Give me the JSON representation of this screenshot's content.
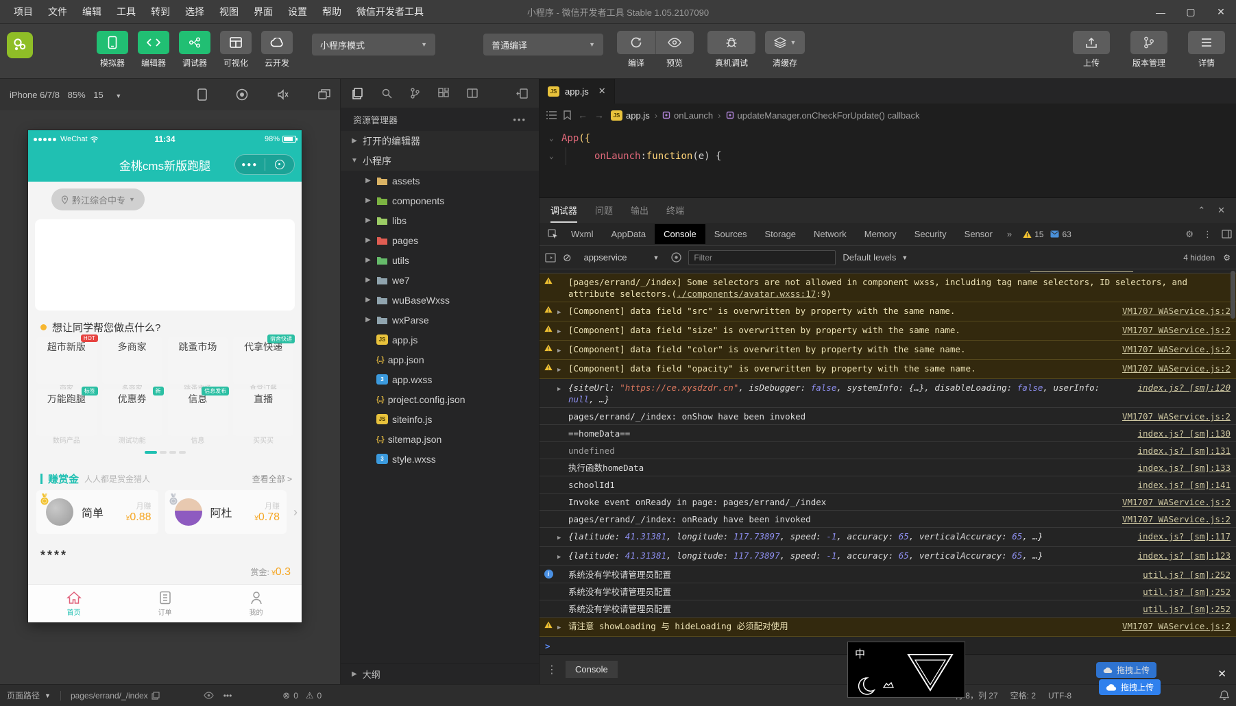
{
  "window": {
    "menu": [
      "项目",
      "文件",
      "编辑",
      "工具",
      "转到",
      "选择",
      "视图",
      "界面",
      "设置",
      "帮助",
      "微信开发者工具"
    ],
    "title": "小程序 - 微信开发者工具 Stable 1.05.2107090"
  },
  "toolbar": {
    "views": [
      {
        "label": "模拟器",
        "icon": "phone",
        "active": true
      },
      {
        "label": "编辑器",
        "icon": "code",
        "active": true
      },
      {
        "label": "调试器",
        "icon": "debug",
        "active": true
      },
      {
        "label": "可视化",
        "icon": "grid",
        "active": false
      },
      {
        "label": "云开发",
        "icon": "cloud",
        "active": false
      }
    ],
    "mode_select": "小程序模式",
    "compile_select": "普通编译",
    "compile_actions": [
      {
        "label": "编译",
        "icon": "refresh"
      },
      {
        "label": "预览",
        "icon": "eye"
      }
    ],
    "device_debug": {
      "label": "真机调试",
      "icon": "bug"
    },
    "cache": {
      "label": "清缓存",
      "icon": "layers"
    },
    "right": [
      {
        "label": "上传",
        "icon": "upload"
      },
      {
        "label": "版本管理",
        "icon": "branch"
      },
      {
        "label": "详情",
        "icon": "menu"
      }
    ]
  },
  "simulator": {
    "device": "iPhone 6/7/8",
    "zoom": "85%",
    "fps": "15"
  },
  "phone": {
    "status": {
      "carrier": "WeChat",
      "time": "11:34",
      "battery": "98%"
    },
    "nav_title": "金桃cms新版跑腿",
    "location": "黔江综合中专",
    "section_title": "想让同学帮您做点什么?",
    "grid": [
      {
        "title": "超市新版",
        "sub": "商家",
        "badge": "HOT",
        "badge_color": "#e64340"
      },
      {
        "title": "多商家",
        "sub": "多商家"
      },
      {
        "title": "跳蚤市场",
        "sub": "跳蚤市场"
      },
      {
        "title": "代拿快递",
        "sub": "食堂订餐",
        "badge": "宿舍快递",
        "badge_color": "#2bbfa3"
      },
      {
        "title": "万能跑腿",
        "sub": "数码产品",
        "badge": "标签",
        "badge_color": "#2bbfa3"
      },
      {
        "title": "优惠券",
        "sub": "测试功能",
        "badge": "新",
        "badge_color": "#2bbfa3"
      },
      {
        "title": "信息",
        "sub": "信息",
        "badge": "信息发布",
        "badge_color": "#2bbfa3"
      },
      {
        "title": "直播",
        "sub": "买买买"
      }
    ],
    "reward": {
      "title": "赚赏金",
      "subtitle": "人人都是赏金猎人",
      "more": "查看全部 >",
      "cards": [
        {
          "name": "简单",
          "label": "月赚",
          "currency": "¥",
          "amount": "0.88",
          "medal": "gold"
        },
        {
          "name": "阿杜",
          "label": "月赚",
          "currency": "¥",
          "amount": "0.78",
          "medal": "silver"
        }
      ]
    },
    "stars": "****",
    "bounty_label": "赏金:",
    "bounty_currency": "¥",
    "bounty_value": "0.3",
    "tabbar": [
      {
        "label": "首页",
        "icon": "home",
        "active": true
      },
      {
        "label": "订单",
        "icon": "order",
        "active": false
      },
      {
        "label": "我的",
        "icon": "me",
        "active": false
      }
    ]
  },
  "explorer": {
    "title": "资源管理器",
    "tree": [
      {
        "label": "打开的编辑器",
        "type": "section",
        "arrow": "right"
      },
      {
        "label": "小程序",
        "type": "section",
        "arrow": "down"
      },
      {
        "label": "assets",
        "type": "folder",
        "color": "#d9b264",
        "arrow": "right"
      },
      {
        "label": "components",
        "type": "folder",
        "color": "#7cb342",
        "arrow": "right"
      },
      {
        "label": "libs",
        "type": "folder",
        "color": "#9ccc65",
        "arrow": "right"
      },
      {
        "label": "pages",
        "type": "folder",
        "color": "#e05d52",
        "arrow": "right"
      },
      {
        "label": "utils",
        "type": "folder",
        "color": "#66bb6a",
        "arrow": "right"
      },
      {
        "label": "we7",
        "type": "folder",
        "color": "#90a4ae",
        "arrow": "right"
      },
      {
        "label": "wuBaseWxss",
        "type": "folder",
        "color": "#90a4ae",
        "arrow": "right"
      },
      {
        "label": "wxParse",
        "type": "folder",
        "color": "#90a4ae",
        "arrow": "right"
      },
      {
        "label": "app.js",
        "type": "js"
      },
      {
        "label": "app.json",
        "type": "json"
      },
      {
        "label": "app.wxss",
        "type": "wxss"
      },
      {
        "label": "project.config.json",
        "type": "json"
      },
      {
        "label": "siteinfo.js",
        "type": "js"
      },
      {
        "label": "sitemap.json",
        "type": "json"
      },
      {
        "label": "style.wxss",
        "type": "wxss"
      }
    ],
    "outline": "大纲"
  },
  "editor": {
    "tab": "app.js",
    "breadcrumb": [
      {
        "label": "app.js",
        "icon": "js"
      },
      {
        "label": "onLaunch",
        "icon": "symbol"
      },
      {
        "label": "updateManager.onCheckForUpdate() callback",
        "icon": "symbol"
      }
    ],
    "code": [
      [
        {
          "t": "App",
          "c": "red"
        },
        {
          "t": "({",
          "c": "gold"
        }
      ],
      [
        {
          "t": "onLaunch",
          "c": "red"
        },
        {
          "t": ": ",
          "c": "plain"
        },
        {
          "t": "function",
          "c": "gold"
        },
        {
          "t": "(e) {",
          "c": "plain"
        }
      ]
    ]
  },
  "debugpanel": {
    "tabs": [
      {
        "label": "调试器",
        "active": true
      },
      {
        "label": "问题",
        "active": false
      },
      {
        "label": "输出",
        "active": false
      },
      {
        "label": "终端",
        "active": false
      }
    ],
    "devtools_tabs": [
      "Wxml",
      "AppData",
      "Console",
      "Sources",
      "Storage",
      "Network",
      "Memory",
      "Security",
      "Sensor"
    ],
    "active_devtools_tab": "Console",
    "warn_count": "15",
    "msg_count": "63",
    "context": "appservice",
    "filter_placeholder": "Filter",
    "levels": "Default levels",
    "hidden_label": "4 hidden",
    "drawer_tab": "Console",
    "rows": [
      {
        "level": "warn",
        "tokens": [
          {
            "t": "[pages/errand/_/index] Some selectors are not allowed in component wxss, including tag name selectors, ID selectors, and attribute selectors.("
          },
          {
            "t": "./components/avatar.wxss:17",
            "c": "link"
          },
          {
            "t": ":9)"
          }
        ]
      },
      {
        "level": "warn",
        "arrow": true,
        "text": "[Component] data field \"src\" is overwritten by property with the same name.",
        "link": "VM1707 WAService.js:2"
      },
      {
        "level": "warn",
        "arrow": true,
        "text": "[Component] data field \"size\" is overwritten by property with the same name.",
        "link": "VM1707 WAService.js:2"
      },
      {
        "level": "warn",
        "arrow": true,
        "text": "[Component] data field \"color\" is overwritten by property with the same name.",
        "link": "VM1707 WAService.js:2"
      },
      {
        "level": "warn",
        "arrow": true,
        "text": "[Component] data field \"opacity\" is overwritten by property with the same name.",
        "link": "VM1707 WAService.js:2"
      },
      {
        "level": "log",
        "arrow": true,
        "italic": true,
        "link": "index.js? [sm]:120",
        "link_top": true,
        "tokens": [
          {
            "t": "{siteUrl: "
          },
          {
            "t": "\"https://ce.xysdzdr.cn\"",
            "c": "str"
          },
          {
            "t": ", isDebugger: "
          },
          {
            "t": "false",
            "c": "kw"
          },
          {
            "t": ", systemInfo: {…}, disableLoading: "
          },
          {
            "t": "false",
            "c": "kw"
          },
          {
            "t": ", userInfo: "
          },
          {
            "t": "null",
            "c": "kw"
          },
          {
            "t": ", …}"
          }
        ]
      },
      {
        "level": "log",
        "text": "pages/errand/_/index: onShow have been invoked",
        "link": "VM1707 WAService.js:2"
      },
      {
        "level": "log",
        "text": "==homeData==",
        "link": "index.js? [sm]:130"
      },
      {
        "level": "log",
        "gray": true,
        "text": "undefined",
        "link": "index.js? [sm]:131"
      },
      {
        "level": "log",
        "text": "执行函数homeData",
        "link": "index.js? [sm]:133"
      },
      {
        "level": "log",
        "text": "schoolId1",
        "link": "index.js? [sm]:141"
      },
      {
        "level": "log",
        "text": "Invoke event onReady in page: pages/errand/_/index",
        "link": "VM1707 WAService.js:2"
      },
      {
        "level": "log",
        "text": "pages/errand/_/index: onReady have been invoked",
        "link": "VM1707 WAService.js:2"
      },
      {
        "level": "log",
        "arrow": true,
        "italic": true,
        "link": "index.js? [sm]:117",
        "tokens": [
          {
            "t": "{latitude: "
          },
          {
            "t": "41.31381",
            "c": "num"
          },
          {
            "t": ", longitude: "
          },
          {
            "t": "117.73897",
            "c": "num"
          },
          {
            "t": ", speed: "
          },
          {
            "t": "-1",
            "c": "num"
          },
          {
            "t": ", accuracy: "
          },
          {
            "t": "65",
            "c": "num"
          },
          {
            "t": ", verticalAccuracy: "
          },
          {
            "t": "65",
            "c": "num"
          },
          {
            "t": ", …}"
          }
        ]
      },
      {
        "level": "log",
        "arrow": true,
        "italic": true,
        "link": "index.js? [sm]:123",
        "tokens": [
          {
            "t": "{latitude: "
          },
          {
            "t": "41.31381",
            "c": "num"
          },
          {
            "t": ", longitude: "
          },
          {
            "t": "117.73897",
            "c": "num"
          },
          {
            "t": ", speed: "
          },
          {
            "t": "-1",
            "c": "num"
          },
          {
            "t": ", accuracy: "
          },
          {
            "t": "65",
            "c": "num"
          },
          {
            "t": ", verticalAccuracy: "
          },
          {
            "t": "65",
            "c": "num"
          },
          {
            "t": ", …}"
          }
        ]
      },
      {
        "level": "info",
        "text": "系统没有学校请管理员配置",
        "link": "util.js? [sm]:252"
      },
      {
        "level": "log",
        "text": "系统没有学校请管理员配置",
        "link": "util.js? [sm]:252"
      },
      {
        "level": "log",
        "text": "系统没有学校请管理员配置",
        "link": "util.js? [sm]:252"
      },
      {
        "level": "warn",
        "arrow": true,
        "text": "请注意 showLoading 与 hideLoading 必须配对使用",
        "link": "VM1707 WAService.js:2"
      }
    ]
  },
  "statusbar": {
    "path_label": "页面路径",
    "path": "pages/errand/_/index",
    "errors": "0",
    "warnings": "0",
    "line_col": "行 8，列 27",
    "spaces": "空格: 2",
    "encoding": "UTF-8"
  },
  "overlays": {
    "ime": "中",
    "drag_upload": "拖拽上传"
  }
}
